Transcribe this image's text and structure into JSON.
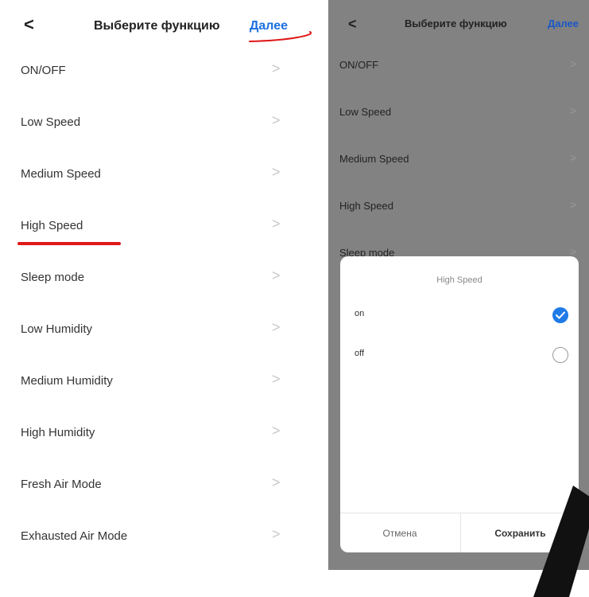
{
  "left_screen": {
    "header": {
      "back_icon": "chevron-left-icon",
      "back_label": "<",
      "title": "Выберите функцию",
      "next_label": "Далее"
    },
    "functions": [
      {
        "label": "ON/OFF"
      },
      {
        "label": "Low Speed"
      },
      {
        "label": "Medium Speed"
      },
      {
        "label": "High Speed"
      },
      {
        "label": "Sleep mode"
      },
      {
        "label": "Low Humidity"
      },
      {
        "label": "Medium Humidity"
      },
      {
        "label": "High Humidity"
      },
      {
        "label": "Fresh Air Mode"
      },
      {
        "label": "Exhausted Air Mode"
      }
    ],
    "chevron": ">",
    "annotation_color": "#e01818"
  },
  "right_screen": {
    "header": {
      "back_icon": "chevron-left-icon",
      "back_label": "<",
      "title": "Выберите функцию",
      "next_label": "Далее"
    },
    "functions": [
      {
        "label": "ON/OFF"
      },
      {
        "label": "Low Speed"
      },
      {
        "label": "Medium Speed"
      },
      {
        "label": "High Speed"
      },
      {
        "label": "Sleep mode"
      }
    ],
    "chevron": ">",
    "dialog": {
      "title": "High Speed",
      "options": [
        {
          "label": "on",
          "selected": true,
          "icon": "checked-radio-icon"
        },
        {
          "label": "off",
          "selected": false,
          "icon": "unchecked-radio-icon"
        }
      ],
      "cancel_label": "Отмена",
      "save_label": "Сохранить"
    }
  },
  "colors": {
    "accent": "#1a6fe0",
    "overlay": "#828282",
    "annotation": "#e01818"
  }
}
